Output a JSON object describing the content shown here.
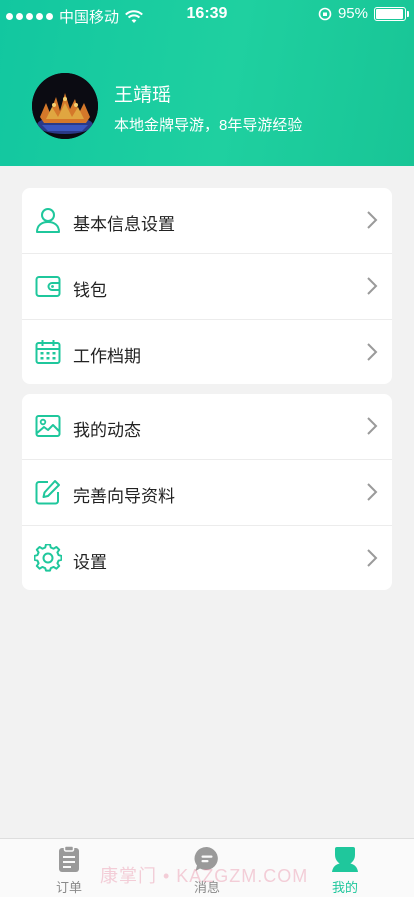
{
  "status_bar": {
    "carrier": "中国移动",
    "time": "16:39",
    "battery_percent": "95%",
    "battery_level": 0.95
  },
  "profile": {
    "name": "王靖瑶",
    "description": "本地金牌导游，8年导游经验"
  },
  "menu_group_1": [
    {
      "label": "基本信息设置",
      "icon": "user-icon"
    },
    {
      "label": "钱包",
      "icon": "wallet-icon"
    },
    {
      "label": "工作档期",
      "icon": "calendar-icon"
    }
  ],
  "menu_group_2": [
    {
      "label": "我的动态",
      "icon": "image-icon"
    },
    {
      "label": "完善向导资料",
      "icon": "edit-icon"
    },
    {
      "label": "设置",
      "icon": "gear-icon"
    }
  ],
  "tabs": [
    {
      "label": "订单",
      "icon": "clipboard-icon",
      "active": false
    },
    {
      "label": "消息",
      "icon": "chat-bubble-icon",
      "active": false
    },
    {
      "label": "我的",
      "icon": "person-icon",
      "active": true
    }
  ],
  "watermark": "康掌门 • KAZGZM.COM",
  "colors": {
    "accent": "#1fc79c",
    "header_start": "#12c7a0",
    "header_end": "#18c596",
    "background": "#f2f2f2"
  }
}
